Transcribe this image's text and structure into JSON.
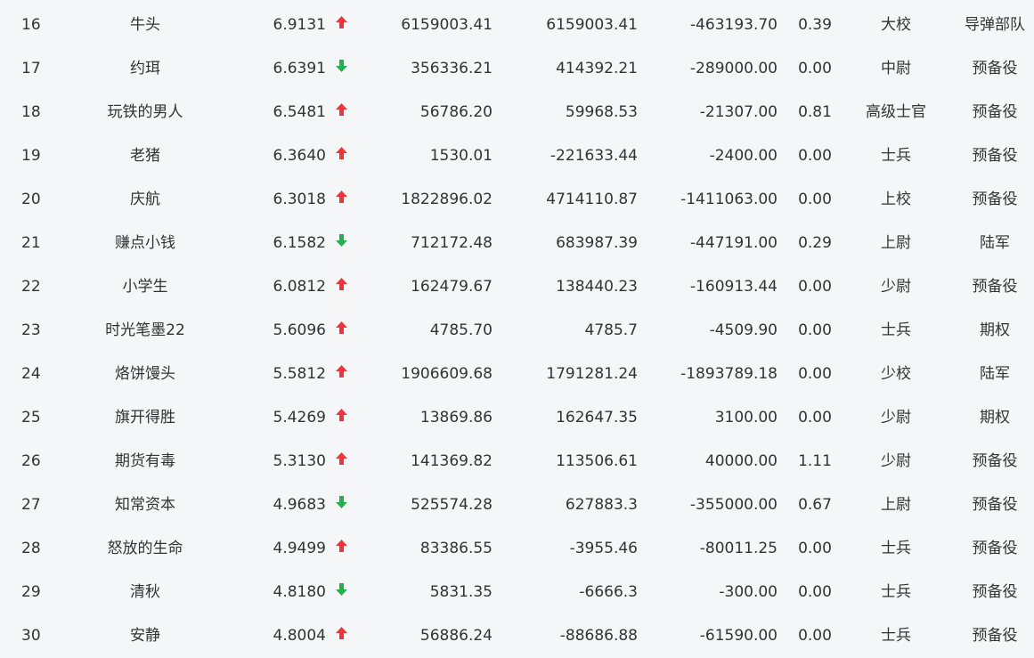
{
  "colors": {
    "up": "#f0343a",
    "down": "#22b14c"
  },
  "rows": [
    {
      "rank": "16",
      "name": "牛头",
      "score": "6.9131",
      "trend": "up",
      "v1": "6159003.41",
      "v2": "6159003.41",
      "v3": "-463193.70",
      "ratio": "0.39",
      "title": "大校",
      "category": "导弹部队"
    },
    {
      "rank": "17",
      "name": "约珥",
      "score": "6.6391",
      "trend": "down",
      "v1": "356336.21",
      "v2": "414392.21",
      "v3": "-289000.00",
      "ratio": "0.00",
      "title": "中尉",
      "category": "预备役"
    },
    {
      "rank": "18",
      "name": "玩铁的男人",
      "score": "6.5481",
      "trend": "up",
      "v1": "56786.20",
      "v2": "59968.53",
      "v3": "-21307.00",
      "ratio": "0.81",
      "title": "高级士官",
      "category": "预备役"
    },
    {
      "rank": "19",
      "name": "老猪",
      "score": "6.3640",
      "trend": "up",
      "v1": "1530.01",
      "v2": "-221633.44",
      "v3": "-2400.00",
      "ratio": "0.00",
      "title": "士兵",
      "category": "预备役"
    },
    {
      "rank": "20",
      "name": "庆航",
      "score": "6.3018",
      "trend": "up",
      "v1": "1822896.02",
      "v2": "4714110.87",
      "v3": "-1411063.00",
      "ratio": "0.00",
      "title": "上校",
      "category": "预备役"
    },
    {
      "rank": "21",
      "name": "赚点小钱",
      "score": "6.1582",
      "trend": "down",
      "v1": "712172.48",
      "v2": "683987.39",
      "v3": "-447191.00",
      "ratio": "0.29",
      "title": "上尉",
      "category": "陆军"
    },
    {
      "rank": "22",
      "name": "小学生",
      "score": "6.0812",
      "trend": "up",
      "v1": "162479.67",
      "v2": "138440.23",
      "v3": "-160913.44",
      "ratio": "0.00",
      "title": "少尉",
      "category": "预备役"
    },
    {
      "rank": "23",
      "name": "时光笔墨22",
      "score": "5.6096",
      "trend": "up",
      "v1": "4785.70",
      "v2": "4785.7",
      "v3": "-4509.90",
      "ratio": "0.00",
      "title": "士兵",
      "category": "期权"
    },
    {
      "rank": "24",
      "name": "烙饼馒头",
      "score": "5.5812",
      "trend": "up",
      "v1": "1906609.68",
      "v2": "1791281.24",
      "v3": "-1893789.18",
      "ratio": "0.00",
      "title": "少校",
      "category": "陆军"
    },
    {
      "rank": "25",
      "name": "旗开得胜",
      "score": "5.4269",
      "trend": "up",
      "v1": "13869.86",
      "v2": "162647.35",
      "v3": "3100.00",
      "ratio": "0.00",
      "title": "少尉",
      "category": "期权"
    },
    {
      "rank": "26",
      "name": "期货有毒",
      "score": "5.3130",
      "trend": "up",
      "v1": "141369.82",
      "v2": "113506.61",
      "v3": "40000.00",
      "ratio": "1.11",
      "title": "少尉",
      "category": "预备役"
    },
    {
      "rank": "27",
      "name": "知常资本",
      "score": "4.9683",
      "trend": "down",
      "v1": "525574.28",
      "v2": "627883.3",
      "v3": "-355000.00",
      "ratio": "0.67",
      "title": "上尉",
      "category": "预备役"
    },
    {
      "rank": "28",
      "name": "怒放的生命",
      "score": "4.9499",
      "trend": "up",
      "v1": "83386.55",
      "v2": "-3955.46",
      "v3": "-80011.25",
      "ratio": "0.00",
      "title": "士兵",
      "category": "预备役"
    },
    {
      "rank": "29",
      "name": "清秋",
      "score": "4.8180",
      "trend": "down",
      "v1": "5831.35",
      "v2": "-6666.3",
      "v3": "-300.00",
      "ratio": "0.00",
      "title": "士兵",
      "category": "预备役"
    },
    {
      "rank": "30",
      "name": "安静",
      "score": "4.8004",
      "trend": "up",
      "v1": "56886.24",
      "v2": "-88686.88",
      "v3": "-61590.00",
      "ratio": "0.00",
      "title": "士兵",
      "category": "预备役"
    }
  ]
}
